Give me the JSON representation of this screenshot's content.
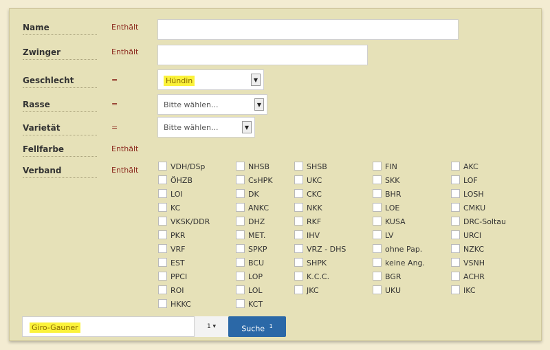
{
  "form": {
    "fields": [
      {
        "label": "Name",
        "op": "Enthält"
      },
      {
        "label": "Zwinger",
        "op": "Enthält"
      },
      {
        "label": "Geschlecht",
        "op": "=",
        "value": "Hündin"
      },
      {
        "label": "Rasse",
        "op": "=",
        "value": "Bitte wählen..."
      },
      {
        "label": "Varietät",
        "op": "=",
        "value": "Bitte wählen..."
      },
      {
        "label": "Fellfarbe",
        "op": "Enthält"
      },
      {
        "label": "Verband",
        "op": "Enthält"
      }
    ],
    "arrow_glyph": "▼",
    "verband_options": [
      [
        "VDH/DSp",
        "NHSB",
        "SHSB",
        "FIN",
        "AKC"
      ],
      [
        "ÖHZB",
        "CsHPK",
        "UKC",
        "SKK",
        "LOF"
      ],
      [
        "LOI",
        "DK",
        "CKC",
        "BHR",
        "LOSH"
      ],
      [
        "KC",
        "ANKC",
        "NKK",
        "LOE",
        "CMKU"
      ],
      [
        "VKSK/DDR",
        "DHZ",
        "RKF",
        "KUSA",
        "DRC-Soltau"
      ],
      [
        "PKR",
        "MET.",
        "IHV",
        "LV",
        "URCI"
      ],
      [
        "VRF",
        "SPKP",
        "VRZ - DHS",
        "ohne Pap.",
        "NZKC"
      ],
      [
        "EST",
        "BCU",
        "SHPK",
        "keine Ang.",
        "VSNH"
      ],
      [
        "PPCI",
        "LOP",
        "K.C.C.",
        "BGR",
        "ACHR"
      ],
      [
        "ROI",
        "LOL",
        "JKC",
        "UKU",
        "IKC"
      ],
      [
        "HKKC",
        "KCT"
      ]
    ]
  },
  "bottom": {
    "search_value": "Giro-Gauner",
    "dropdown_label": "1 ▾",
    "search_button": "Suche",
    "search_button_badge": "1"
  }
}
